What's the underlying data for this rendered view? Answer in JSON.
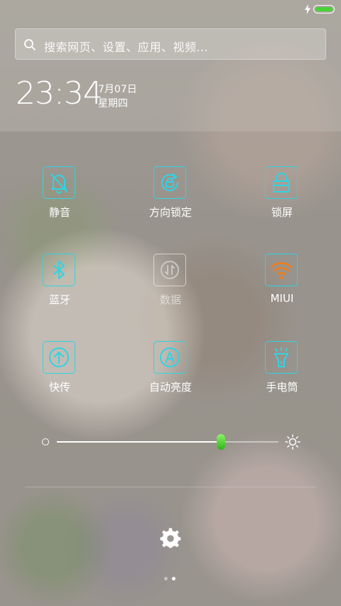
{
  "status_bar": {
    "battery_level": 1.0
  },
  "search": {
    "placeholder": "搜索网页、设置、应用、视频..."
  },
  "clock": {
    "time": "23:34",
    "date": "7月07日",
    "weekday": "星期四"
  },
  "toggles": [
    {
      "label": "静音",
      "icon": "bell-off-icon",
      "state": "on"
    },
    {
      "label": "方向锁定",
      "icon": "rotation-lock-icon",
      "state": "on"
    },
    {
      "label": "锁屏",
      "icon": "lock-icon",
      "state": "on"
    },
    {
      "label": "蓝牙",
      "icon": "bluetooth-icon",
      "state": "on"
    },
    {
      "label": "数据",
      "icon": "mobile-data-icon",
      "state": "off"
    },
    {
      "label": "MIUI",
      "icon": "wifi-icon",
      "state": "on"
    },
    {
      "label": "快传",
      "icon": "quick-share-icon",
      "state": "on"
    },
    {
      "label": "自动亮度",
      "icon": "auto-brightness-icon",
      "state": "on"
    },
    {
      "label": "手电筒",
      "icon": "flashlight-icon",
      "state": "on"
    }
  ],
  "brightness": {
    "level": 0.74
  },
  "pager": {
    "pages": 2,
    "current": 2
  },
  "colors": {
    "accent": "#2fd4e4",
    "wifi": "#f07d1c",
    "battery": "#46d436",
    "slider_thumb": "#3cc820",
    "inactive": "#c9c6c2"
  }
}
